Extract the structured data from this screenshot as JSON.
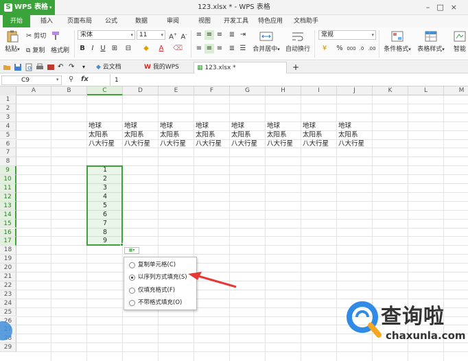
{
  "app": {
    "name": "WPS 表格",
    "doc_title": "123.xlsx * - WPS 表格"
  },
  "menu_tabs": [
    "开始",
    "插入",
    "页面布局",
    "公式",
    "数据",
    "审阅",
    "视图",
    "开发工具",
    "特色应用",
    "文档助手"
  ],
  "ribbon": {
    "paste": "粘贴",
    "cut": "剪切",
    "copy": "复制",
    "format_painter": "格式刷",
    "font_name": "宋体",
    "font_size": "11",
    "bold": "B",
    "italic": "I",
    "underline": "U",
    "merge_center": "合并居中",
    "wrap_text": "自动换行",
    "number_format": "常规",
    "percent": "%",
    "currency": "¥",
    "conditional_format": "条件格式",
    "table_style": "表格样式",
    "smart": "智能"
  },
  "doc_tabs": [
    {
      "label": "云文档"
    },
    {
      "label": "我的WPS"
    },
    {
      "label": "123.xlsx *"
    }
  ],
  "formula_bar": {
    "cell_ref": "C9",
    "fx": "fx",
    "value": "1"
  },
  "columns": [
    "A",
    "B",
    "C",
    "D",
    "E",
    "F",
    "G",
    "H",
    "I",
    "J",
    "K",
    "L",
    "M"
  ],
  "rows": [
    "1",
    "2",
    "3",
    "4",
    "5",
    "6",
    "7",
    "8",
    "9",
    "10",
    "11",
    "12",
    "13",
    "14",
    "15",
    "16",
    "17",
    "18",
    "19",
    "20",
    "21",
    "22",
    "23",
    "24",
    "25",
    "26",
    "27",
    "28",
    "29"
  ],
  "text_block": [
    "地球",
    "太阳系",
    "八大行星"
  ],
  "filled_numbers": [
    "1",
    "2",
    "3",
    "4",
    "5",
    "6",
    "7",
    "8",
    "9"
  ],
  "popup": {
    "items": [
      {
        "label": "复制单元格(C)",
        "selected": false
      },
      {
        "label": "以序列方式填充(S)",
        "selected": true
      },
      {
        "label": "仅填充格式(F)",
        "selected": false
      },
      {
        "label": "不带格式填充(O)",
        "selected": false
      }
    ]
  },
  "watermark": {
    "name": "查询啦",
    "url": "chaxunla.com"
  },
  "colors": {
    "accent": "#3aa33a",
    "arrow": "#e53935",
    "watermark_blue": "#2f8be6"
  }
}
